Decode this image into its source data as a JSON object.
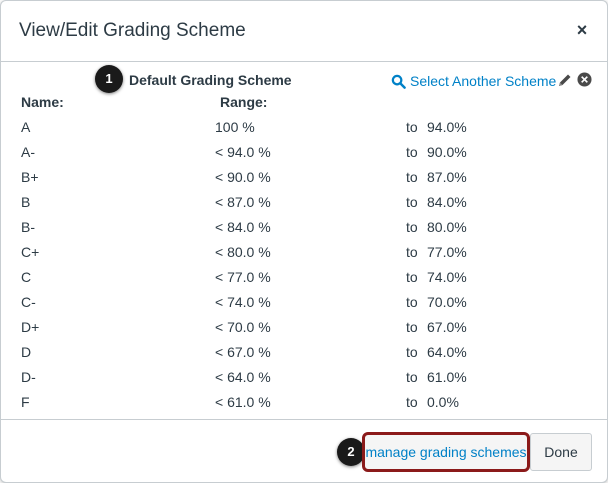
{
  "dialog": {
    "title": "View/Edit Grading Scheme",
    "close_label": "×"
  },
  "scheme": {
    "title": "Default Grading Scheme",
    "select_label": "Select Another Scheme",
    "name_header": "Name:",
    "range_header": "Range:",
    "rows": [
      {
        "grade": "A",
        "max": "100 %",
        "to": "to",
        "min": "94.0%"
      },
      {
        "grade": "A-",
        "max": "< 94.0 %",
        "to": "to",
        "min": "90.0%"
      },
      {
        "grade": "B+",
        "max": "< 90.0 %",
        "to": "to",
        "min": "87.0%"
      },
      {
        "grade": "B",
        "max": "< 87.0 %",
        "to": "to",
        "min": "84.0%"
      },
      {
        "grade": "B-",
        "max": "< 84.0 %",
        "to": "to",
        "min": "80.0%"
      },
      {
        "grade": "C+",
        "max": "< 80.0 %",
        "to": "to",
        "min": "77.0%"
      },
      {
        "grade": "C",
        "max": "< 77.0 %",
        "to": "to",
        "min": "74.0%"
      },
      {
        "grade": "C-",
        "max": "< 74.0 %",
        "to": "to",
        "min": "70.0%"
      },
      {
        "grade": "D+",
        "max": "< 70.0 %",
        "to": "to",
        "min": "67.0%"
      },
      {
        "grade": "D",
        "max": "< 67.0 %",
        "to": "to",
        "min": "64.0%"
      },
      {
        "grade": "D-",
        "max": "< 64.0 %",
        "to": "to",
        "min": "61.0%"
      },
      {
        "grade": "F",
        "max": "< 61.0 %",
        "to": "to",
        "min": "0.0%"
      }
    ]
  },
  "footer": {
    "manage_label": "manage grading schemes",
    "done_label": "Done"
  },
  "callouts": [
    "1",
    "2"
  ],
  "colors": {
    "link": "#0081c7",
    "callout_bg": "#1a1a1a",
    "highlight_border": "#8b1a1a",
    "text": "#2d3b45"
  },
  "icons": {
    "search": "search-icon",
    "edit": "pencil-icon",
    "remove": "remove-circle-icon",
    "close": "close-icon"
  }
}
